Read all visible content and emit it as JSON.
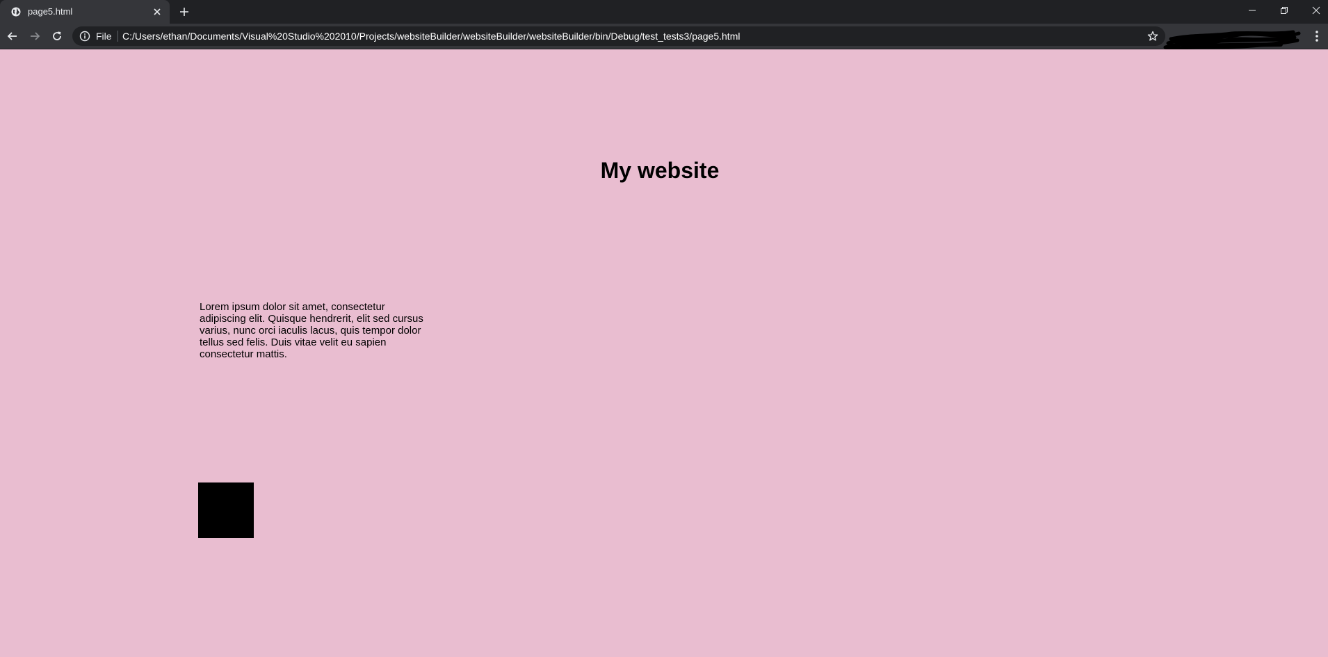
{
  "browser": {
    "tab": {
      "title": "page5.html",
      "favicon": "globe-icon",
      "close_icon": "close-icon"
    },
    "new_tab_icon": "plus-icon",
    "window_controls": [
      "minimize-icon",
      "restore-icon",
      "close-icon"
    ],
    "toolbar": {
      "back_icon": "back-arrow-icon",
      "forward_icon": "forward-arrow-icon",
      "reload_icon": "reload-icon",
      "site_info_icon": "info-icon",
      "scheme_label": "File",
      "url": "C:/Users/ethan/Documents/Visual%20Studio%202010/Projects/websiteBuilder/websiteBuilder/websiteBuilder/bin/Debug/test_tests3/page5.html",
      "bookmark_icon": "star-icon",
      "menu_icon": "kebab-menu-icon"
    },
    "colors": {
      "tabstrip": "#202124",
      "toolbar": "#35363a",
      "omnibox": "#202124"
    }
  },
  "page": {
    "heading": "My website",
    "paragraph": "Lorem ipsum dolor sit amet, consectetur adipiscing elit. Quisque hendrerit, elit sed cursus varius, nunc orci iaculis lacus, quis tempor dolor tellus sed felis. Duis vitae velit eu sapien consectetur mattis.",
    "colors": {
      "background": "#e9bdd0",
      "text": "#000000",
      "box": "#000000"
    }
  }
}
